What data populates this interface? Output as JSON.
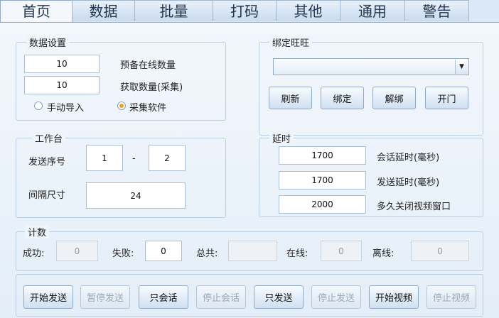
{
  "tabs": [
    "首页",
    "数据",
    "批量",
    "打码",
    "其他",
    "通用",
    "警告"
  ],
  "data_settings": {
    "title": "数据设置",
    "reserve_online_value": "10",
    "reserve_online_label": "预备在线数量",
    "fetch_count_value": "10",
    "fetch_count_label": "获取数量(采集)",
    "radio_manual_label": "手动导入",
    "radio_collect_label": "采集软件",
    "selected": "采集软件"
  },
  "bind_wangwang": {
    "title": "绑定旺旺",
    "select_value": "",
    "buttons": {
      "refresh": "刷新",
      "bind": "绑定",
      "unbind": "解绑",
      "open": "开门"
    }
  },
  "workbench": {
    "title": "工作台",
    "send_seq_label": "发送序号",
    "seq_from": "1",
    "dash": "-",
    "seq_to": "2",
    "interval_label": "间隔尺寸",
    "interval_value": "24"
  },
  "delay": {
    "title": "延时",
    "session_delay_value": "1700",
    "session_delay_label": "会话延时(毫秒)",
    "send_delay_value": "1700",
    "send_delay_label": "发送延时(毫秒)",
    "close_video_value": "2000",
    "close_video_label": "多久关闭视频窗口"
  },
  "count": {
    "title": "计数",
    "success_label": "成功:",
    "success_value": "0",
    "fail_label": "失败:",
    "fail_value": "0",
    "total_label": "总共:",
    "total_value": "",
    "online_label": "在线:",
    "online_value": "0",
    "offline_label": "离线:",
    "offline_value": "0"
  },
  "actions": {
    "start_send": "开始发送",
    "pause_send": "暂停发送",
    "session_only": "只会话",
    "stop_session": "停止会话",
    "send_only": "只发送",
    "stop_send": "停止发送",
    "start_video": "开始视频",
    "stop_video": "停止视频"
  },
  "colors": {
    "accent": "#f0a21a",
    "background": "#dbe8f6",
    "border": "#8fa9c6"
  }
}
